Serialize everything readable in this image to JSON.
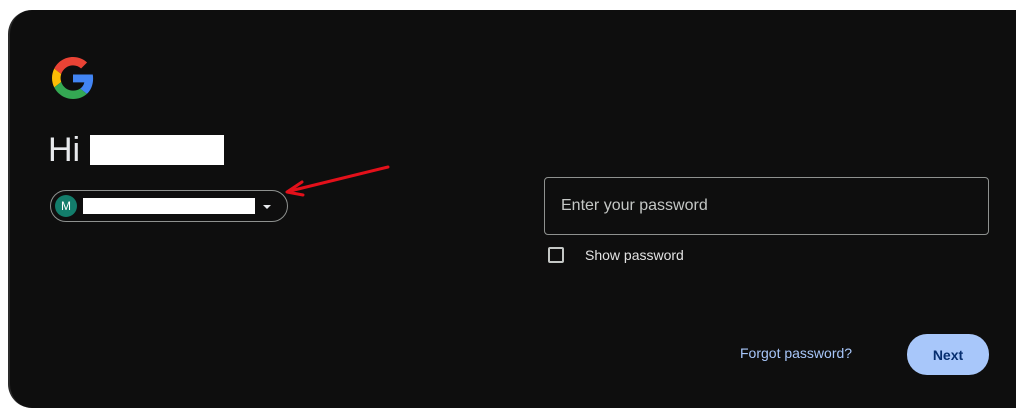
{
  "greeting": {
    "text": "Hi"
  },
  "account_chip": {
    "avatar_initial": "M",
    "chevron_icon": "chevron-down-icon"
  },
  "password": {
    "placeholder": "Enter your password",
    "value": "",
    "show_password_label": "Show password",
    "show_password_checked": false
  },
  "actions": {
    "forgot_password_label": "Forgot password?",
    "next_label": "Next"
  },
  "colors": {
    "background": "#0e0e0e",
    "accent": "#a8c7fa",
    "avatar": "#137d6b",
    "annotation_arrow": "#e3101a"
  }
}
